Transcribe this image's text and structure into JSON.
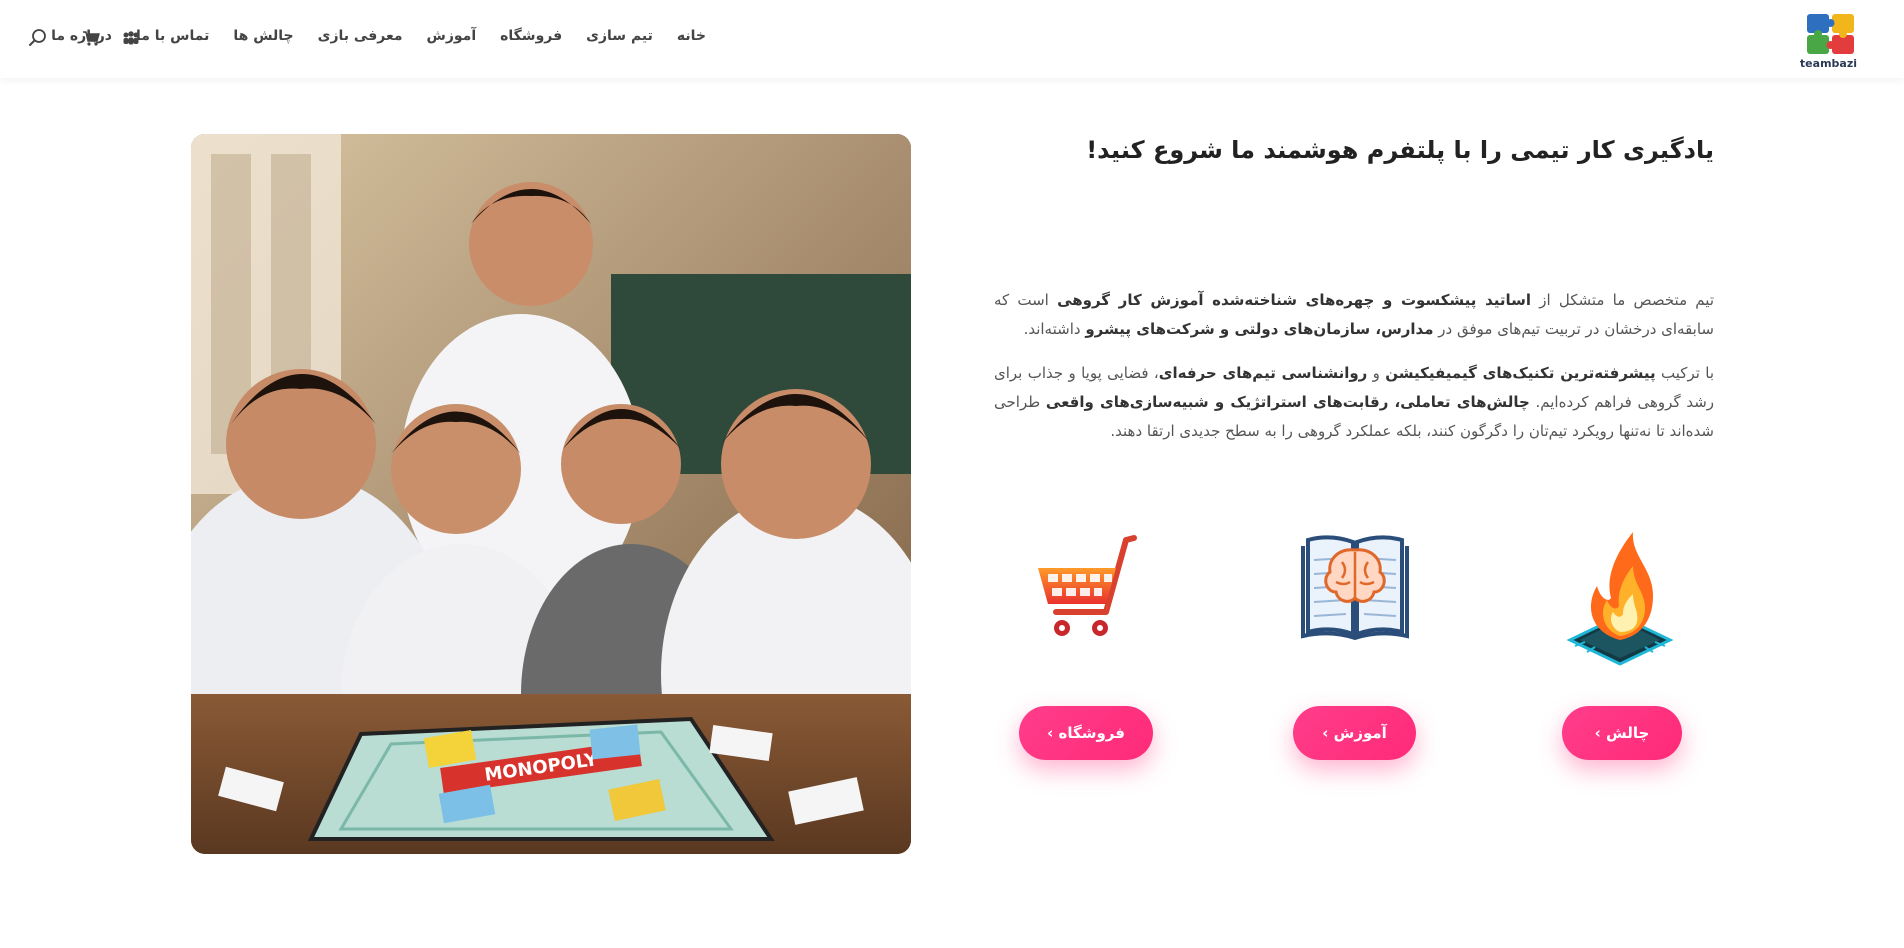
{
  "brand": {
    "name": "teambazi"
  },
  "nav": {
    "items": [
      {
        "label": "خانه"
      },
      {
        "label": "تیم سازی"
      },
      {
        "label": "فروشگاه"
      },
      {
        "label": "آموزش"
      },
      {
        "label": "معرفی بازی"
      },
      {
        "label": "چالش ها"
      },
      {
        "label": "تماس با ما"
      },
      {
        "label": "درباره ما"
      }
    ],
    "icons": [
      "team-icon",
      "cart-icon",
      "search-icon"
    ]
  },
  "hero": {
    "title": "یادگیری کار تیمی را با پلتفرم هوشمند ما شروع کنید!",
    "p1": {
      "t1": "تیم متخصص ما متشکل از ",
      "b1": "اساتید پیشکسوت و چهره‌های شناخته‌شده آموزش کار گروهی",
      "t2": " است که سابقه‌ای درخشان در تربیت تیم‌های موفق در ",
      "b2": "مدارس، سازمان‌های دولتی و شرکت‌های پیشرو",
      "t3": " داشته‌اند."
    },
    "p2": {
      "t1": "با ترکیب ",
      "b1": "پیشرفته‌ترین تکنیک‌های گیمیفیکیشن",
      "t2": " و ",
      "b2": "روانشناسی تیم‌های حرفه‌ای",
      "t3": "، فضایی پویا و جذاب برای رشد گروهی فراهم کرده‌ایم. ",
      "b3": "چالش‌های تعاملی، رقابت‌های استراتژیک و شبیه‌سازی‌های واقعی",
      "t4": " طراحی شده‌اند تا نه‌تنها رویکرد تیم‌تان را دگرگون کنند، بلکه عملکرد گروهی را به سطح جدیدی ارتقا دهند."
    },
    "image_alt": "MONOPOLY"
  },
  "features": [
    {
      "icon": "fire-chip-icon",
      "button": "چالش ›"
    },
    {
      "icon": "brain-book-icon",
      "button": "آموزش ›"
    },
    {
      "icon": "shopping-cart-icon",
      "button": "فروشگاه ›"
    }
  ],
  "colors": {
    "accent": "#ff2f7e",
    "brand_blue": "#2a3a55"
  }
}
